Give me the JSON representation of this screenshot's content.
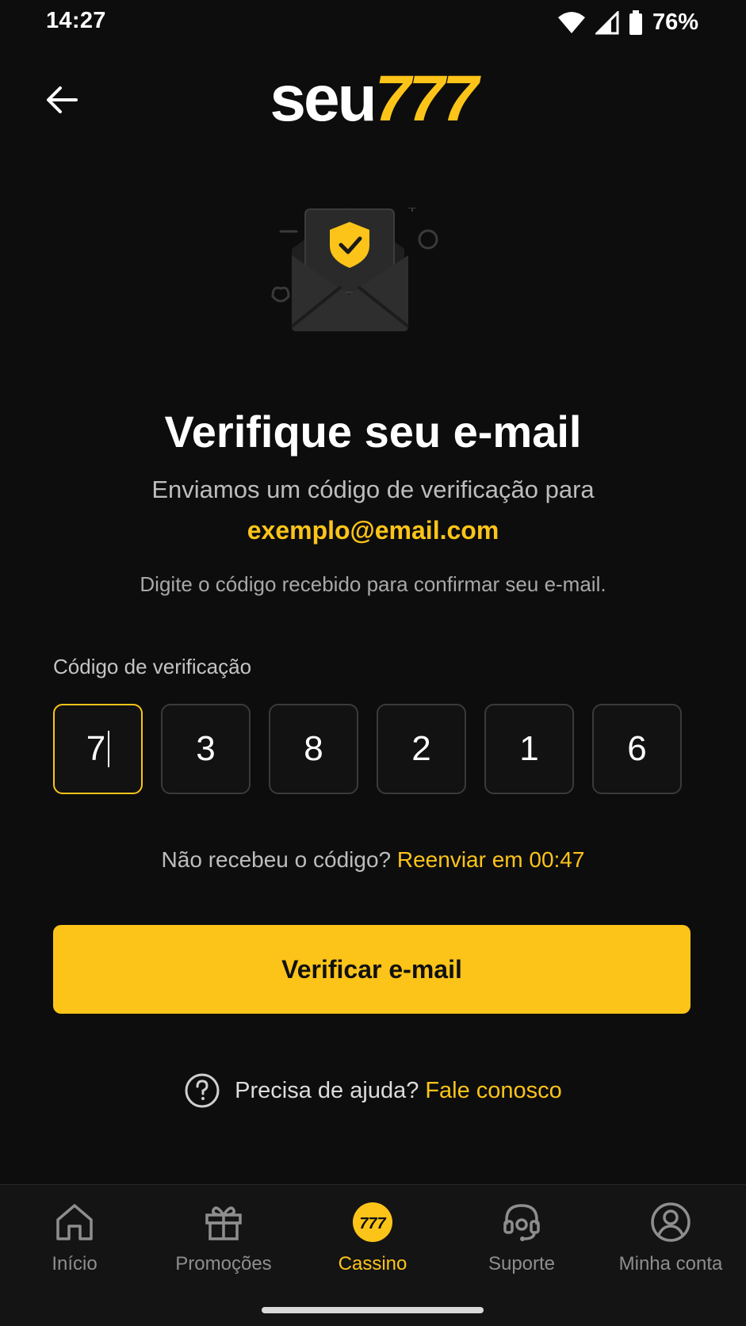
{
  "status": {
    "time": "14:27",
    "battery": "76%"
  },
  "header": {
    "logo_white": "seu",
    "logo_yellow": "777"
  },
  "main": {
    "title": "Verifique seu e-mail",
    "subtitle": "Enviamos um código de verificação para",
    "email": "exemplo@email.com",
    "instruction": "Digite o código recebido para confirmar seu e-mail.",
    "code_label": "Código de verificação",
    "code_digits": [
      "7",
      "3",
      "8",
      "2",
      "1",
      "6"
    ],
    "resend_question": "Não recebeu o código?",
    "resend_link": "Reenviar em 00:47",
    "verify_button": "Verificar e-mail",
    "help_text": "Precisa de ajuda?",
    "help_link": "Fale conosco"
  },
  "nav": {
    "items": [
      {
        "label": "Início",
        "icon": "home-icon"
      },
      {
        "label": "Promoções",
        "icon": "gift-icon"
      },
      {
        "label": "Cassino",
        "icon": "casino-777-icon"
      },
      {
        "label": "Suporte",
        "icon": "headset-icon"
      },
      {
        "label": "Minha conta",
        "icon": "user-circle-icon"
      }
    ],
    "active_index": 2
  },
  "colors": {
    "accent": "#fcc419",
    "background": "#0d0d0d"
  }
}
